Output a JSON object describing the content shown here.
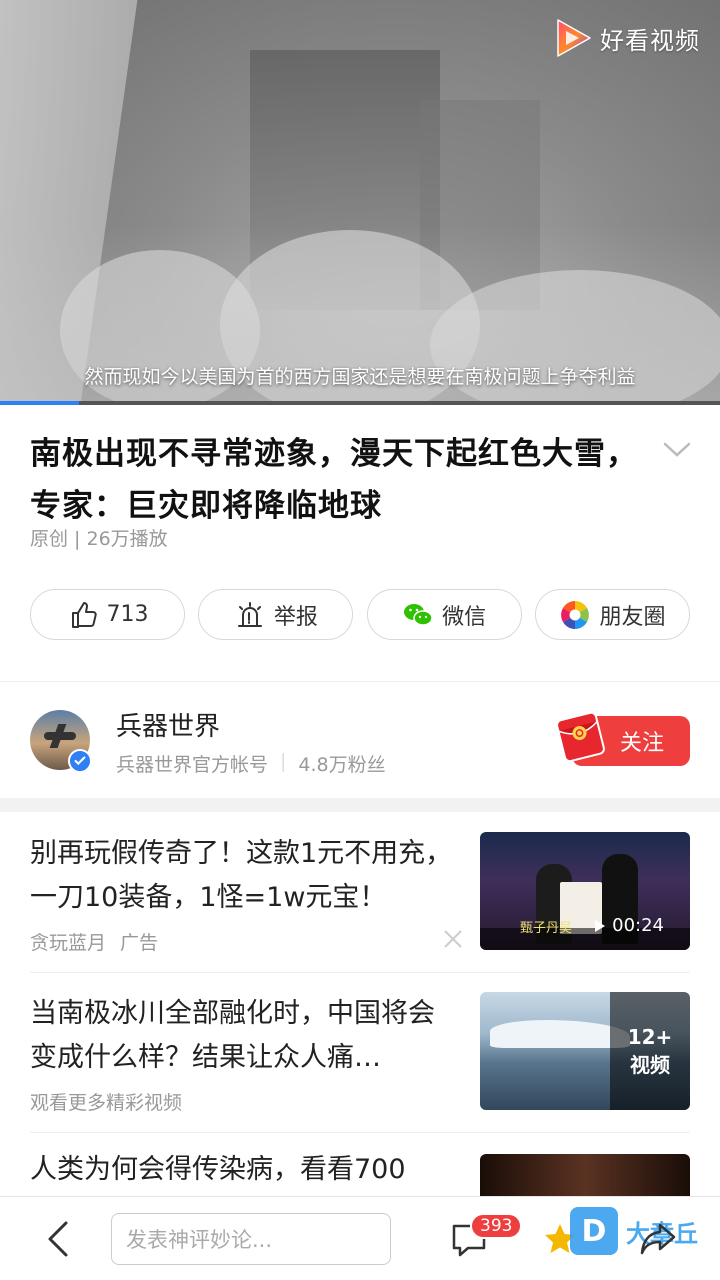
{
  "video": {
    "brand": "好看视频",
    "subtitle": "然而现如今以美国为首的西方国家还是想要在南极问题上争夺利益",
    "progress": 0.11
  },
  "article": {
    "title": "南极出现不寻常迹象，漫天下起红色大雪，专家：巨灾即将降临地球",
    "meta": "原创 | 26万播放"
  },
  "actions": {
    "like_count": "713",
    "report": "举报",
    "wechat": "微信",
    "moments": "朋友圈"
  },
  "author": {
    "name": "兵器世界",
    "description": "兵器世界官方帐号",
    "fans": "4.8万粉丝",
    "follow": "关注"
  },
  "feed": [
    {
      "title": "别再玩假传奇了！这款1元不用充，一刀10装备，1怪=1w元宝！",
      "source": "贪玩蓝月",
      "tag": "广告",
      "duration": "00:24",
      "thumb_caption": "甄子丹吴"
    },
    {
      "title": "当南极冰川全部融化时，中国将会变成什么样？结果让众人痛…",
      "source": "观看更多精彩视频",
      "overlay_count": "12+",
      "overlay_label": "视频"
    },
    {
      "title": "人类为何会得传染病，看看700"
    }
  ],
  "bottom_bar": {
    "comment_placeholder": "发表神评妙论...",
    "comment_count": "393",
    "watermark_letter": "D",
    "watermark_text": "大章丘"
  },
  "colors": {
    "accent_red": "#ef3e3e",
    "progress_blue": "#2f7ff5",
    "watermark_blue": "#3aa0ee"
  }
}
